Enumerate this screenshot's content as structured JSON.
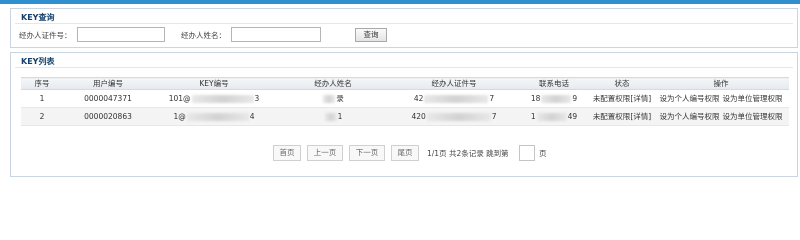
{
  "query": {
    "title": "KEY查询",
    "id_label": "经办人证件号：",
    "id_value": "",
    "name_label": "经办人姓名：",
    "name_value": "",
    "query_button": "查询"
  },
  "list": {
    "title": "KEY列表",
    "columns": [
      "序号",
      "用户编号",
      "KEY编号",
      "经办人姓名",
      "经办人证件号",
      "联系电话",
      "状态",
      "操作"
    ],
    "rows": [
      {
        "seq": "1",
        "user_no": "0000047371",
        "key_prefix": "101@",
        "key_suffix": "3",
        "name_suffix": "录",
        "id_prefix": "42",
        "id_suffix": "7",
        "phone_prefix": "18",
        "phone_suffix": "9",
        "status": "未配置权限",
        "detail": "[详情]",
        "op_personal": "设为个人编号权限",
        "op_unit": "设为单位管理权限"
      },
      {
        "seq": "2",
        "user_no": "0000020863",
        "key_prefix": "1@",
        "key_suffix": "4",
        "name_suffix": "1",
        "id_prefix": "420",
        "id_suffix": "7",
        "phone_prefix": "1",
        "phone_suffix": "49",
        "status": "未配置权限",
        "detail": "[详情]",
        "op_personal": "设为个人编号权限",
        "op_unit": "设为单位管理权限"
      }
    ]
  },
  "pager": {
    "first": "首页",
    "prev": "上一页",
    "next": "下一页",
    "last": "尾页",
    "summary": "1/1页 共2条记录 跳到第",
    "page_input": "",
    "page_suffix": "页"
  }
}
